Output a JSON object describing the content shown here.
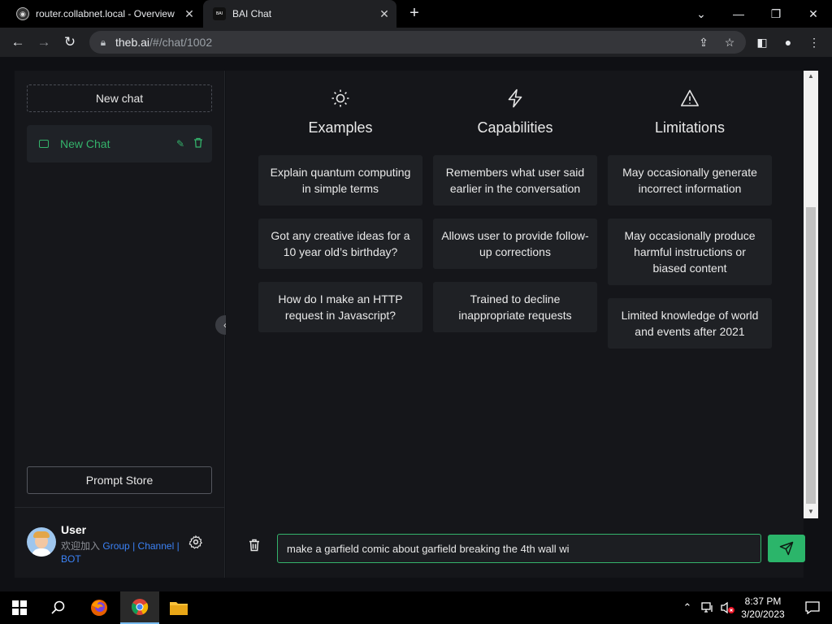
{
  "browser": {
    "tabs": [
      {
        "title": "router.collabnet.local - Overview",
        "active": false
      },
      {
        "title": "BAI Chat",
        "active": true,
        "favicon_text": "BAI"
      }
    ],
    "url_host": "theb.ai",
    "url_path": "/#/chat/1002"
  },
  "sidebar": {
    "new_chat_label": "New chat",
    "chats": [
      {
        "label": "New Chat",
        "selected": true
      }
    ],
    "prompt_store_label": "Prompt Store",
    "user": {
      "name": "User",
      "welcome": "欢迎加入",
      "links": [
        "Group",
        "Channel",
        "BOT"
      ]
    }
  },
  "main": {
    "columns": [
      {
        "title": "Examples",
        "icon": "sun-icon",
        "cards": [
          "Explain quantum computing in simple terms",
          "Got any creative ideas for a 10 year old’s birthday?",
          "How do I make an HTTP request in Javascript?"
        ]
      },
      {
        "title": "Capabilities",
        "icon": "lightning-icon",
        "cards": [
          "Remembers what user said earlier in the conversation",
          "Allows user to provide follow-up corrections",
          "Trained to decline inappropriate requests"
        ]
      },
      {
        "title": "Limitations",
        "icon": "warning-icon",
        "cards": [
          "May occasionally generate incorrect information",
          "May occasionally produce harmful instructions or biased content",
          "Limited knowledge of world and events after 2021"
        ]
      }
    ],
    "composer_value": "make a garfield comic about garfield breaking the 4th wall wi"
  },
  "taskbar": {
    "time": "8:37 PM",
    "date": "3/20/2023"
  },
  "colors": {
    "accent": "#34b36b",
    "send_button": "#2bb56a",
    "link": "#3b82f6"
  }
}
